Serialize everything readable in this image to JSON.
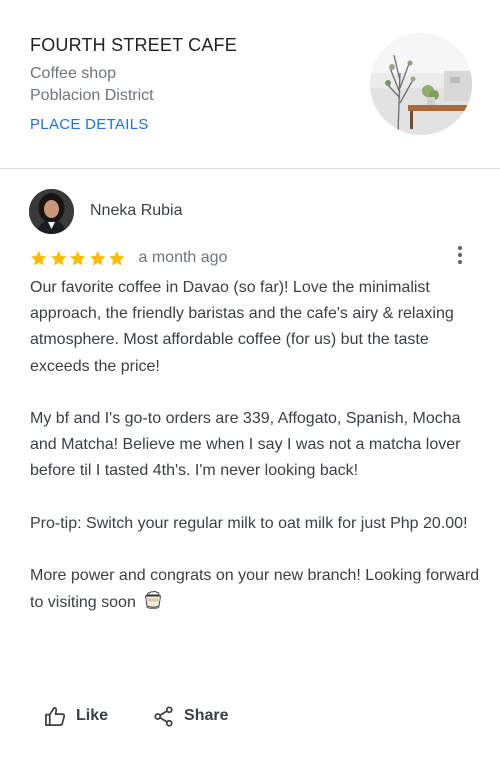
{
  "place": {
    "name": "FOURTH STREET CAFE",
    "type": "Coffee shop",
    "area": "Poblacion District",
    "details_link": "PLACE DETAILS"
  },
  "review": {
    "author": "Nneka Rubia",
    "rating": 5,
    "rating_max": 5,
    "time": "a month ago",
    "paragraphs": [
      "Our favorite coffee in Davao (so far)! Love the minimalist approach, the friendly baristas and the cafe's airy & relaxing atmosphere. Most affordable coffee (for us) but the taste exceeds the price!",
      "My bf and I's go-to orders are 339, Affogato, Spanish, Mocha and Matcha! Believe me when I say I was not a matcha lover before til I tasted 4th's. I'm never looking back!",
      "Pro-tip: Switch your regular milk to oat milk for just Php 20.00!",
      "More power and congrats on your new branch! Looking forward to visiting soon"
    ],
    "trailing_icon": "coffee-cup-icon"
  },
  "actions": {
    "like_label": "Like",
    "share_label": "Share"
  },
  "colors": {
    "accent": "#1a73e8",
    "star": "#fbbc04",
    "secondary_text": "#70757a",
    "divider": "#dadce0"
  }
}
